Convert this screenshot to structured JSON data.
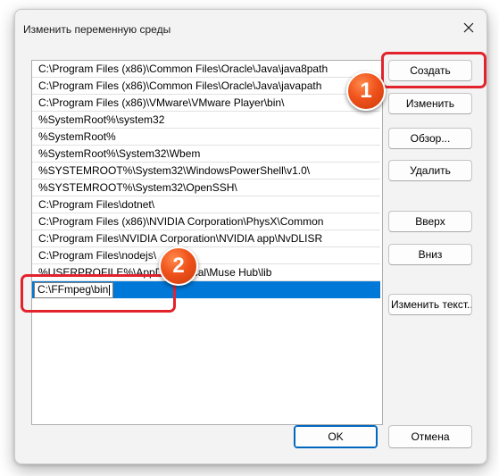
{
  "window": {
    "title": "Изменить переменную среды",
    "close_icon": "close-icon"
  },
  "paths": [
    "C:\\Program Files (x86)\\Common Files\\Oracle\\Java\\java8path",
    "C:\\Program Files (x86)\\Common Files\\Oracle\\Java\\javapath",
    "C:\\Program Files (x86)\\VMware\\VMware Player\\bin\\",
    "%SystemRoot%\\system32",
    "%SystemRoot%",
    "%SystemRoot%\\System32\\Wbem",
    "%SYSTEMROOT%\\System32\\WindowsPowerShell\\v1.0\\",
    "%SYSTEMROOT%\\System32\\OpenSSH\\",
    "C:\\Program Files\\dotnet\\",
    "C:\\Program Files (x86)\\NVIDIA Corporation\\PhysX\\Common",
    "C:\\Program Files\\NVIDIA Corporation\\NVIDIA app\\NvDLISR",
    "C:\\Program Files\\nodejs\\",
    "%USERPROFILE%\\AppData\\Local\\Muse Hub\\lib"
  ],
  "editing_value": "C:\\FFmpeg\\bin",
  "buttons": {
    "create": "Создать",
    "edit": "Изменить",
    "browse": "Обзор...",
    "delete": "Удалить",
    "up": "Вверх",
    "down": "Вниз",
    "edit_text": "Изменить текст...",
    "ok": "OK",
    "cancel": "Отмена"
  },
  "annotations": {
    "step1": "1",
    "step2": "2"
  },
  "colors": {
    "accent": "#0078d7",
    "highlight": "#e3232c",
    "badge": "#f0521b"
  }
}
